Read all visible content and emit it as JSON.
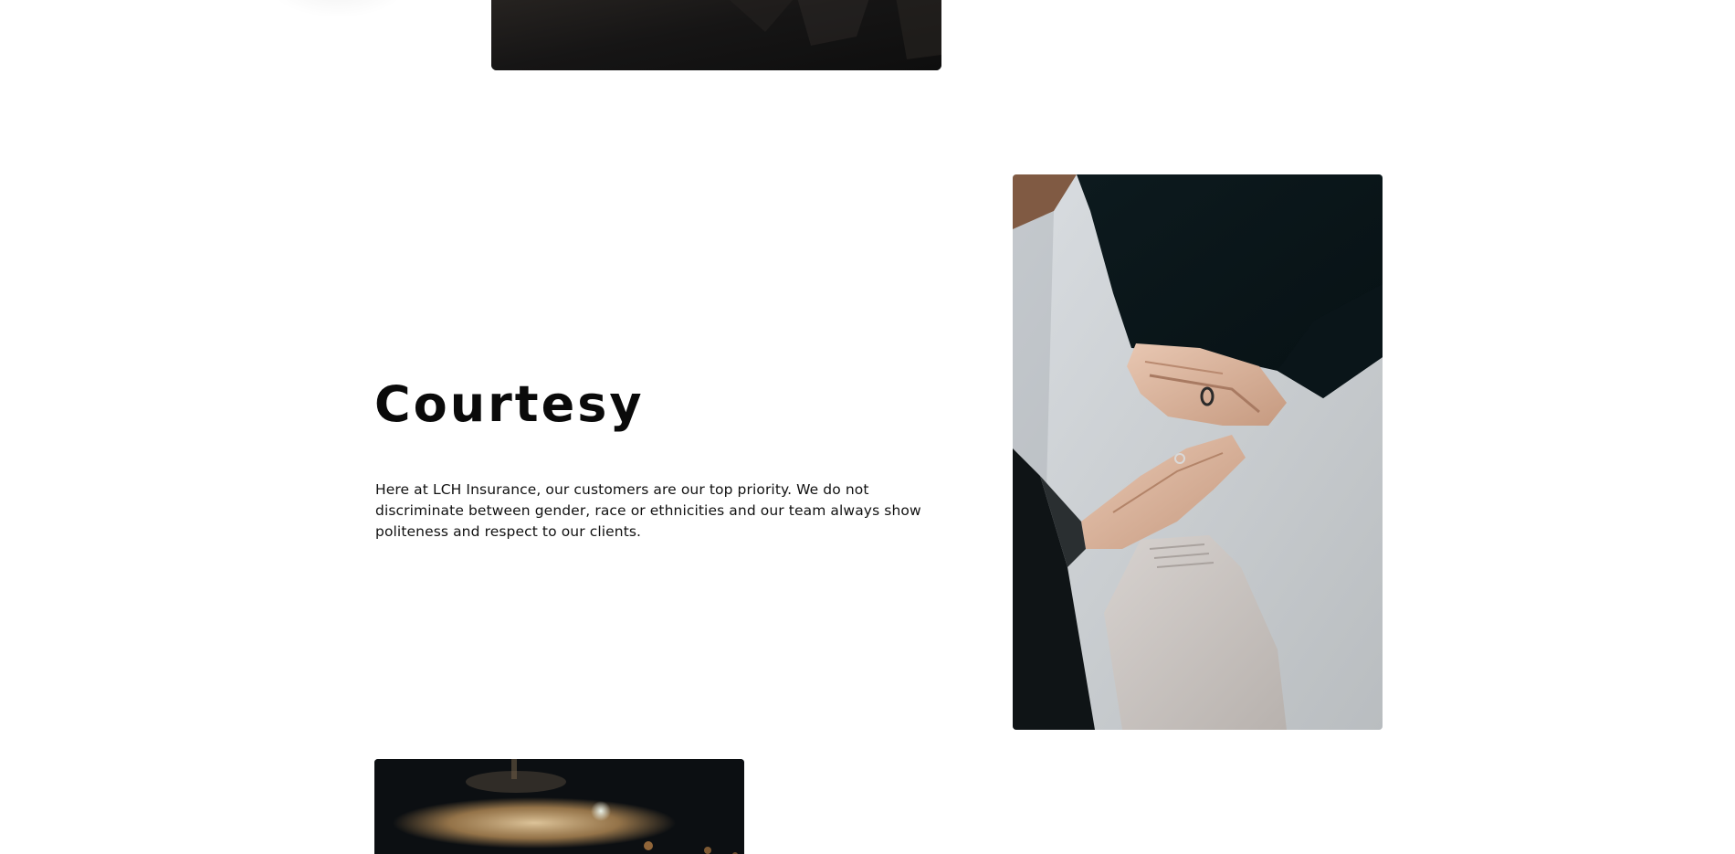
{
  "section": {
    "heading": "Courtesy",
    "body": "Here at LCH Insurance, our customers are our top priority. We do not discriminate between gender, race or ethnicities and our team always show politeness and respect to our clients."
  },
  "images": {
    "top": "photo-dark",
    "hands": "photo-stacked-hands",
    "bottom": "photo-blurred-lights"
  },
  "colors": {
    "background": "#ffffff",
    "text": "#0a0a0a"
  }
}
